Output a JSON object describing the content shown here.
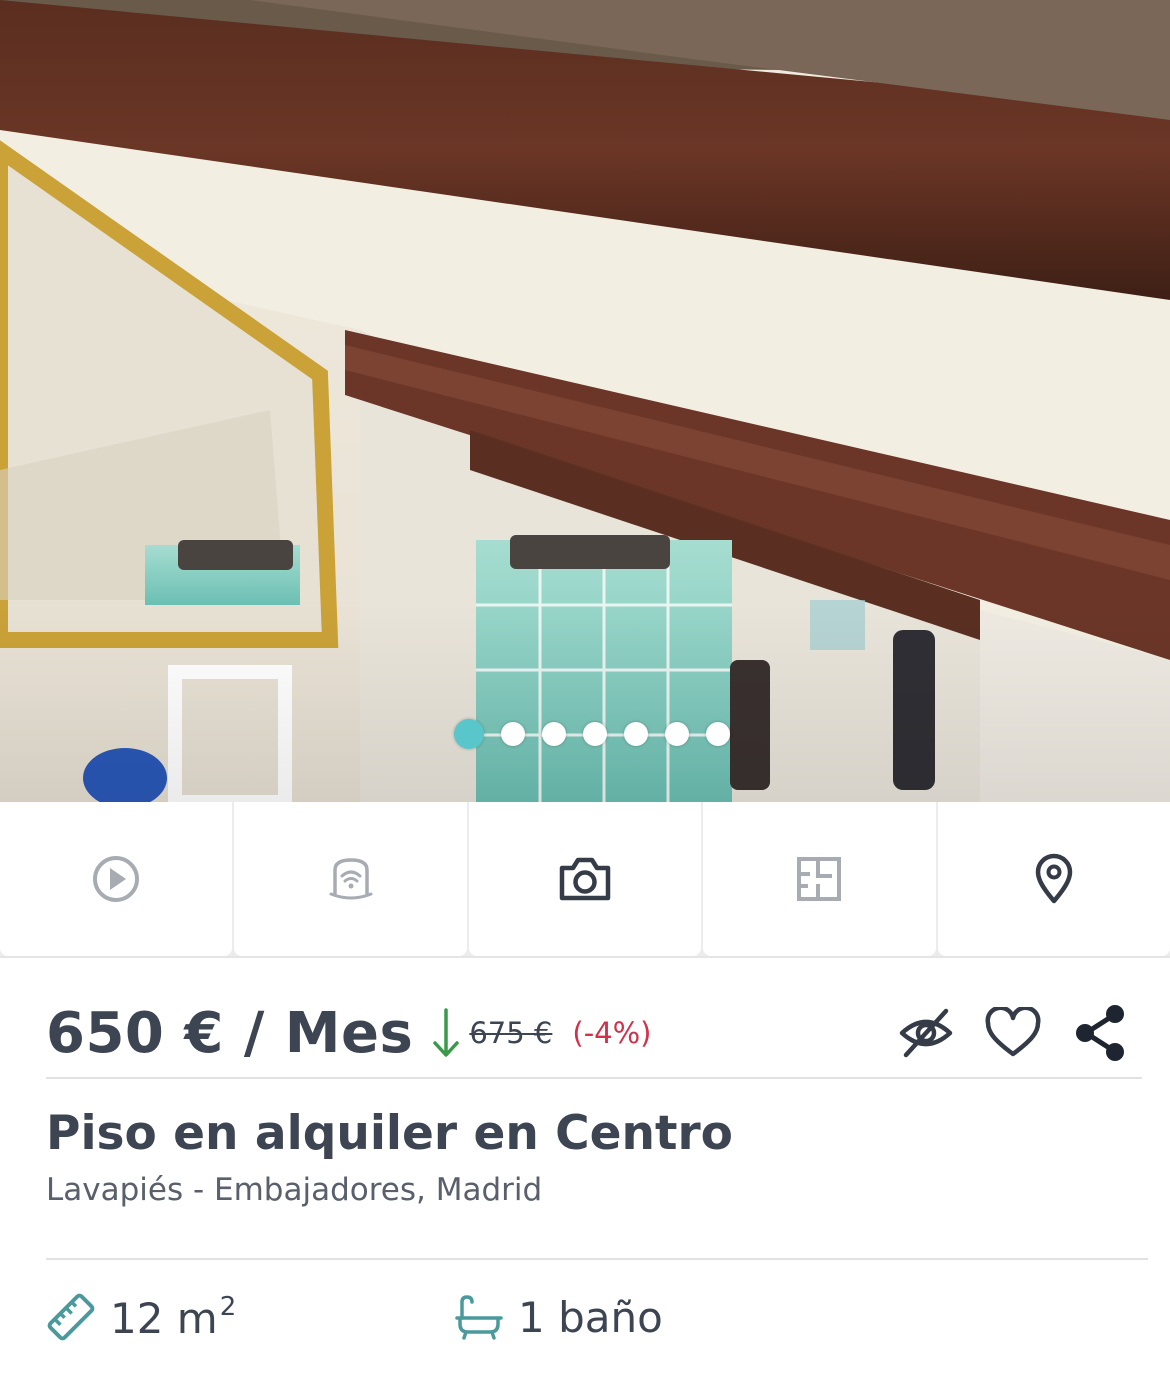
{
  "gallery": {
    "photo_count": 7,
    "active_index": 0
  },
  "media_tabs": [
    {
      "name": "video",
      "icon": "play-circle-icon"
    },
    {
      "name": "virtual-tour",
      "icon": "360-tour-icon"
    },
    {
      "name": "photos",
      "icon": "camera-icon",
      "active": true
    },
    {
      "name": "floor-plan",
      "icon": "floor-plan-icon"
    },
    {
      "name": "map",
      "icon": "map-pin-icon"
    }
  ],
  "listing": {
    "price": "650 € / Mes",
    "old_price": "675 €",
    "discount": "(-4%)",
    "title": "Piso en alquiler en Centro",
    "location": "Lavapiés - Embajadores, Madrid",
    "area_value": "12 m",
    "area_unit_sup": "2",
    "bathrooms": "1 baño"
  },
  "actions": {
    "hide_icon": "eye-off-icon",
    "favorite_icon": "heart-icon",
    "share_icon": "share-icon"
  },
  "colors": {
    "accent": "#59c6cc",
    "price_text": "#3d4452",
    "discount": "#d0314b",
    "price_drop_arrow": "#3a9a4a",
    "feature_icon": "#4a9a9c"
  }
}
